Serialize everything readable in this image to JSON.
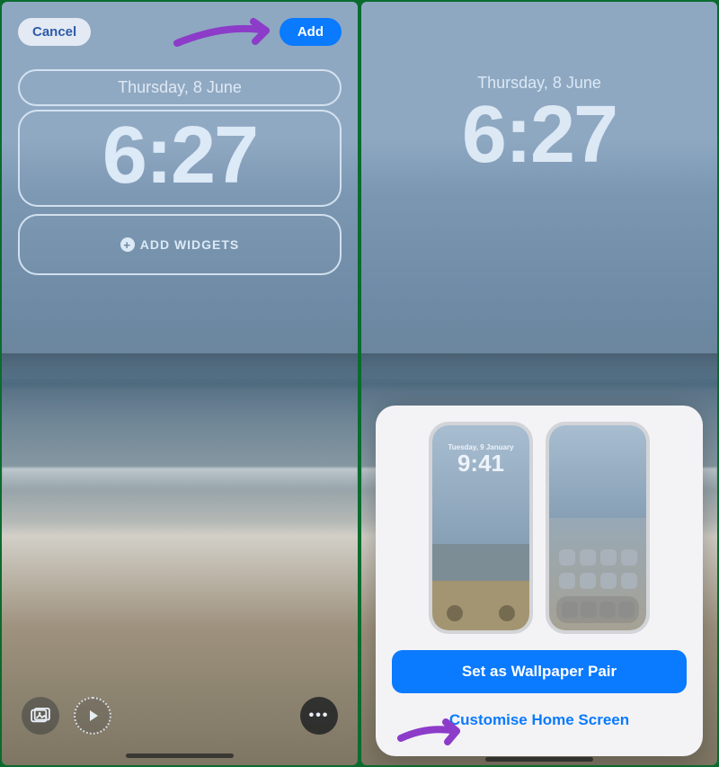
{
  "date": "Thursday, 8 June",
  "time": "6:27",
  "left": {
    "cancel": "Cancel",
    "add": "Add",
    "add_widgets": "ADD WIDGETS"
  },
  "right": {
    "preview_date": "Tuesday, 9 January",
    "preview_time": "9:41",
    "set_pair": "Set as Wallpaper Pair",
    "customise": "Customise Home Screen"
  },
  "colors": {
    "accent": "#0a7aff",
    "annotation": "#8c3cc8"
  }
}
